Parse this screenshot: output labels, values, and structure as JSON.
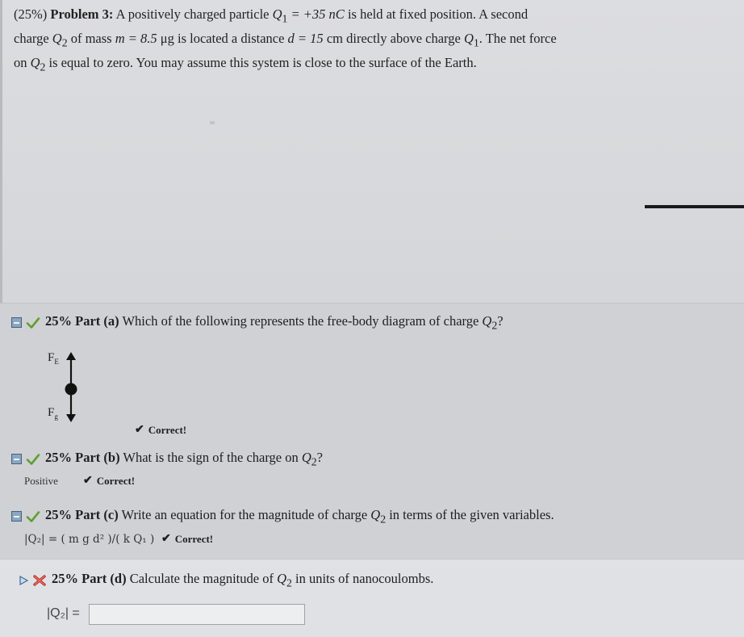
{
  "problem": {
    "line1_prefix": "(25%) ",
    "line1_bold": "Problem 3:",
    "line1_text": " A positively charged particle ",
    "q1_sym": "Q",
    "q1_sub": "1",
    "q1_value": " = +35 nC",
    "line1_text2": " is held at fixed position. A second",
    "line2_a": "charge ",
    "q2_sym": "Q",
    "q2_sub": "2",
    "line2_b": " of mass ",
    "m_sym": "m",
    "m_value": " = 8.5",
    "m_unit": " μg",
    "line2_c": " is located a distance ",
    "d_sym": "d",
    "d_value": " = 15",
    "d_unit": " cm",
    "line2_d": " directly above charge ",
    "line2_e": ". The net force",
    "line3_a": "on ",
    "line3_b": " is equal to zero. You may assume this system is close to the surface of the Earth."
  },
  "part_a": {
    "pct": "25% Part (a)",
    "question": " Which of the following represents the free-body diagram of charge ",
    "q": "Q",
    "q_sub": "2",
    "end": "?",
    "fe_label": "F",
    "fe_sub": "E",
    "fg_label": "F",
    "fg_sub": "g",
    "correct": "Correct!"
  },
  "part_b": {
    "pct": "25% Part (b)",
    "question": " What is the sign of the charge on ",
    "q": "Q",
    "q_sub": "2",
    "end": "?",
    "answer": "Positive",
    "correct": "Correct!"
  },
  "part_c": {
    "pct": "25% Part (c)",
    "question": " Write an equation for the magnitude of charge ",
    "q": "Q",
    "q_sub": "2",
    "end": " in terms of the given variables.",
    "answer": "|Q₂| = ( m g d² )/( k Q₁ )",
    "correct": "Correct!"
  },
  "part_d": {
    "pct": "25% Part (d)",
    "question": " Calculate the magnitude of ",
    "q": "Q",
    "q_sub": "2",
    "end": " in units of nanocoulombs.",
    "input_label": "|Q₂| =",
    "input_value": ""
  },
  "colors": {
    "check_green": "#5e9b3b",
    "x_red": "#c0392b",
    "minus_blue": "#8aa6c0"
  },
  "icons": {
    "collapse": "minus-box-icon",
    "correct": "checkmark-icon",
    "incorrect": "x-icon",
    "expand": "play-triangle-icon"
  }
}
